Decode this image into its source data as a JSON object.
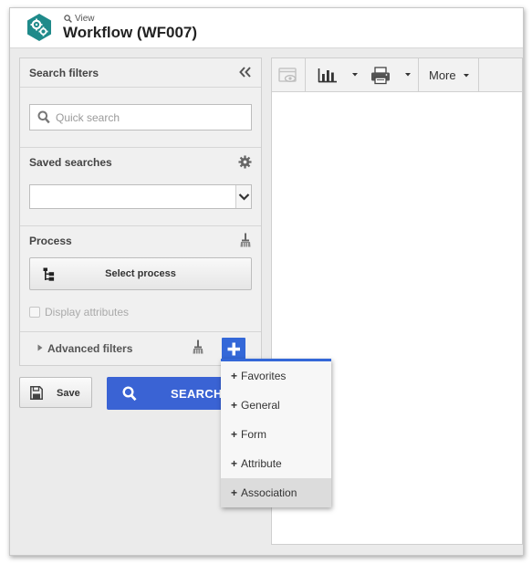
{
  "header": {
    "crumb_label": "View",
    "title": "Workflow (WF007)"
  },
  "filters": {
    "title": "Search filters",
    "quick_search_placeholder": "Quick search",
    "saved_searches_title": "Saved searches",
    "saved_searches_value": "",
    "process_title": "Process",
    "select_process_label": "Select process",
    "display_attributes_label": "Display attributes",
    "display_attributes_checked": false,
    "advanced_filters_label": "Advanced filters"
  },
  "actions": {
    "save_label": "Save",
    "search_label": "SEARCH"
  },
  "toolbar": {
    "more_label": "More"
  },
  "menu": {
    "items": [
      {
        "label": "Favorites"
      },
      {
        "label": "General"
      },
      {
        "label": "Form"
      },
      {
        "label": "Attribute"
      },
      {
        "label": "Association"
      }
    ],
    "highlighted_item": "Association"
  },
  "colors": {
    "accent": "#3468d8",
    "search_button": "#3a63d4",
    "logo": "#1f8a8a"
  }
}
